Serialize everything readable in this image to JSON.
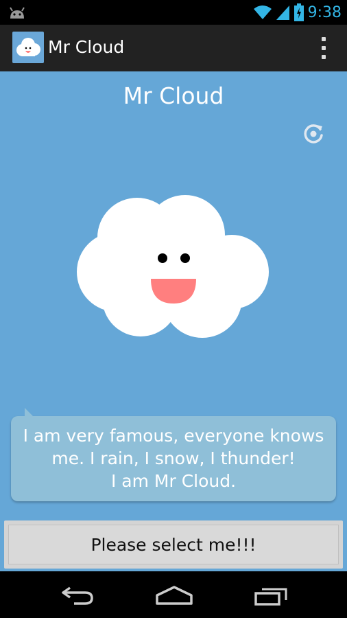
{
  "status_bar": {
    "time": "9:38"
  },
  "action_bar": {
    "title": "Mr Cloud"
  },
  "main": {
    "title": "Mr Cloud",
    "speech_bubble": {
      "lines": [
        "I am very famous, everyone knows",
        "me. I rain, I snow, I thunder!",
        "I am Mr Cloud."
      ]
    },
    "select_button_label": "Please select me!!!"
  },
  "colors": {
    "background_blue": "#65a7d7",
    "bubble": "#8fbfd8",
    "status_accent": "#33b5e5",
    "mouth": "#ff7f7f"
  },
  "icons": {
    "status": [
      "android-icon",
      "wifi-icon",
      "signal-icon",
      "battery-icon"
    ],
    "action_bar": [
      "app-logo-icon",
      "overflow-menu-icon"
    ],
    "main": [
      "refresh-icon"
    ],
    "nav": [
      "back-icon",
      "home-icon",
      "recent-apps-icon"
    ]
  }
}
